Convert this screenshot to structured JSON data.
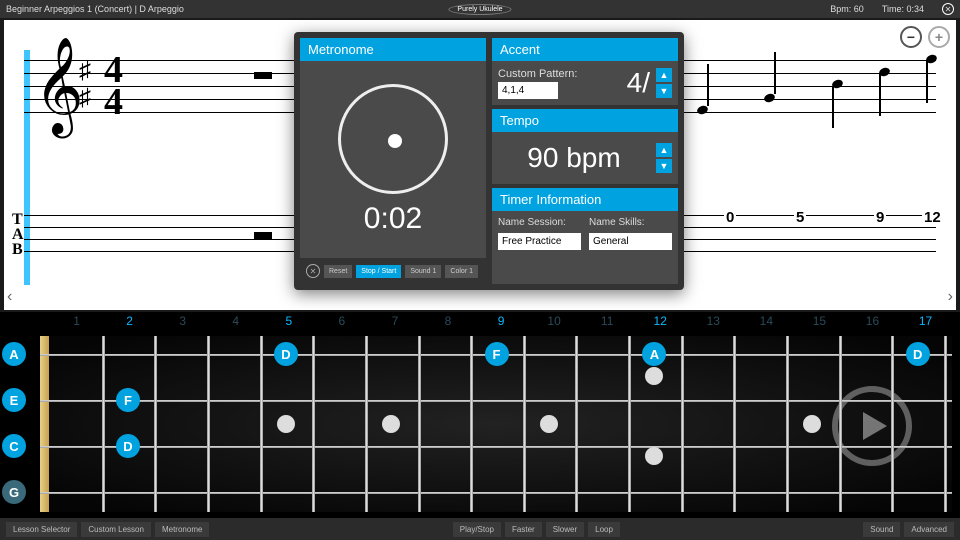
{
  "topbar": {
    "title": "Beginner Arpeggios 1 (Concert)  |  D Arpeggio",
    "brand": "Purely Ukulele",
    "bpm_label": "Bpm: 60",
    "time_label": "Time: 0:34"
  },
  "notation": {
    "time_sig_top": "4",
    "time_sig_bot": "4",
    "tab_letters": [
      "T",
      "A",
      "B"
    ],
    "tab_numbers": [
      "0",
      "5",
      "9",
      "12"
    ]
  },
  "panel": {
    "metronome": {
      "title": "Metronome",
      "elapsed": "0:02",
      "buttons": {
        "reset": "Reset",
        "stopstart": "Stop / Start",
        "sound": "Sound 1",
        "color": "Color 1"
      }
    },
    "accent": {
      "title": "Accent",
      "pattern_label": "Custom Pattern:",
      "pattern_value": "4,1,4",
      "display": "4/"
    },
    "tempo": {
      "title": "Tempo",
      "display": "90 bpm"
    },
    "timer": {
      "title": "Timer Information",
      "session_label": "Name Session:",
      "session_value": "Free Practice",
      "skills_label": "Name Skills:",
      "skills_value": "General"
    }
  },
  "fretboard": {
    "fret_count": 17,
    "highlighted_frets": [
      2,
      5,
      9,
      12,
      17
    ],
    "open_strings": [
      "A",
      "E",
      "C",
      "G"
    ],
    "notes": [
      {
        "fret": 5,
        "string": 0,
        "label": "D"
      },
      {
        "fret": 9,
        "string": 0,
        "label": "F"
      },
      {
        "fret": 12,
        "string": 0,
        "label": "A"
      },
      {
        "fret": 17,
        "string": 0,
        "label": "D"
      },
      {
        "fret": 2,
        "string": 1,
        "label": "F"
      },
      {
        "fret": 2,
        "string": 2,
        "label": "D"
      }
    ],
    "inlays_single": [
      5,
      7,
      10,
      15
    ],
    "inlays_double": [
      12
    ]
  },
  "bottombar": {
    "left": {
      "lesson": "Lesson Selector",
      "custom": "Custom Lesson",
      "metronome": "Metronome"
    },
    "center": {
      "playstop": "Play/Stop",
      "faster": "Faster",
      "slower": "Slower",
      "loop": "Loop"
    },
    "right": {
      "sound": "Sound",
      "advanced": "Advanced"
    }
  }
}
